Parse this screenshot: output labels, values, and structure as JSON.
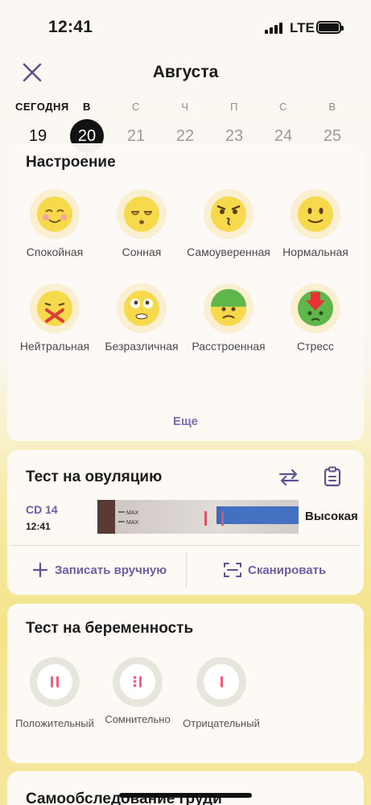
{
  "status": {
    "time": "12:41",
    "network": "LTE"
  },
  "header": {
    "month": "Августа",
    "close_icon": "close-icon"
  },
  "week": [
    {
      "dow": "СЕГОДНЯ",
      "num": "19",
      "state": "today",
      "dot": true
    },
    {
      "dow": "В",
      "num": "20",
      "state": "selected",
      "dot": true
    },
    {
      "dow": "С",
      "num": "21",
      "state": "",
      "dot": false
    },
    {
      "dow": "Ч",
      "num": "22",
      "state": "",
      "dot": false
    },
    {
      "dow": "П",
      "num": "23",
      "state": "",
      "dot": false
    },
    {
      "dow": "С",
      "num": "24",
      "state": "",
      "dot": false
    },
    {
      "dow": "В",
      "num": "25",
      "state": "",
      "dot": false
    }
  ],
  "mood": {
    "title": "Настроение",
    "items": [
      {
        "label": "Спокойная",
        "icon": "calm-face-icon"
      },
      {
        "label": "Сонная",
        "icon": "sleepy-face-icon"
      },
      {
        "label": "Самоуверенная",
        "icon": "confident-face-icon"
      },
      {
        "label": "Нормальная",
        "icon": "normal-face-icon"
      },
      {
        "label": "Нейтральная",
        "icon": "neutral-face-icon"
      },
      {
        "label": "Безразличная",
        "icon": "indifferent-face-icon"
      },
      {
        "label": "Расстроенная",
        "icon": "upset-face-icon"
      },
      {
        "label": "Стресс",
        "icon": "stress-face-icon"
      }
    ],
    "more": "Еще"
  },
  "ovulation": {
    "title": "Тест на овуляцию",
    "cd": "CD 14",
    "time": "12:41",
    "strip_text": "MAX",
    "result": "Высокая",
    "manual": "Записать вручную",
    "scan": "Сканировать"
  },
  "pregnancy": {
    "title": "Тест на беременность",
    "items": [
      {
        "label": "Положительный",
        "icon": "positive-test-icon"
      },
      {
        "label": "Сомнительно",
        "icon": "doubtful-test-icon"
      },
      {
        "label": "Отрицательный",
        "icon": "negative-test-icon"
      }
    ]
  },
  "breast": {
    "title": "Самообследование груди"
  },
  "colors": {
    "accent": "#6a5ea6",
    "test_line": "#ff5a7a",
    "face": "#f7d94c"
  }
}
